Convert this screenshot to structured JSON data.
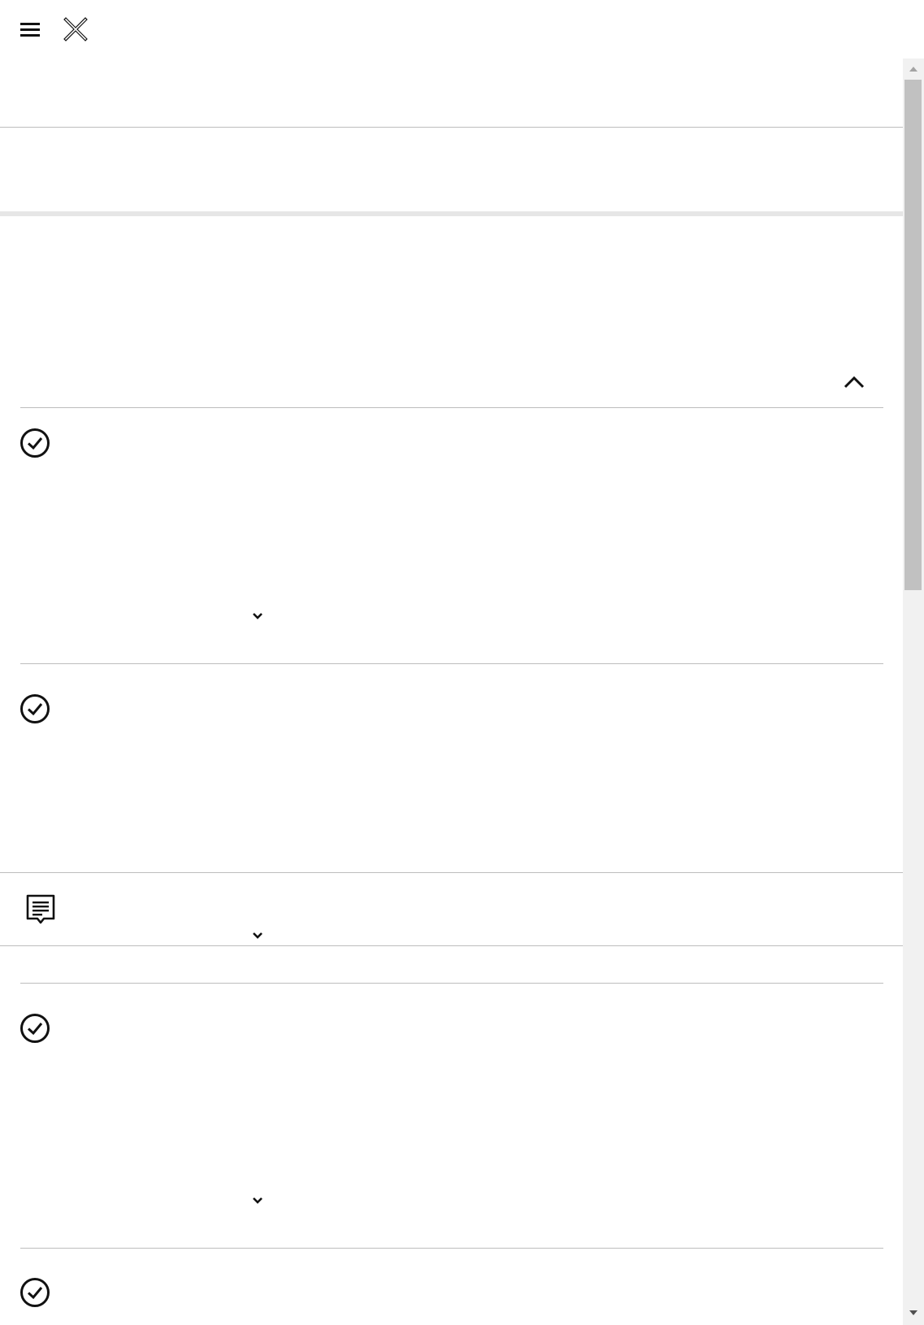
{
  "toolbar": {
    "menu_icon": "hamburger-menu-icon",
    "close_icon": "close-x-icon"
  },
  "sections": [
    {
      "id": "item-1",
      "icon": "check-circle-icon",
      "has_expand": true
    },
    {
      "id": "item-2",
      "icon": "check-circle-icon",
      "has_expand": false
    },
    {
      "id": "comment",
      "icon": "comment-icon",
      "has_expand": true
    },
    {
      "id": "item-3",
      "icon": "check-circle-icon",
      "has_expand": true
    },
    {
      "id": "item-4",
      "icon": "check-circle-icon",
      "has_expand": false
    }
  ],
  "collapse_icon": "chevron-up-icon",
  "expand_icon": "chevron-down-icon",
  "colors": {
    "divider": "#bdbdbd",
    "band": "#e6e6e6",
    "scroll_track": "#f1f1f1",
    "scroll_thumb": "#c1c1c1"
  }
}
